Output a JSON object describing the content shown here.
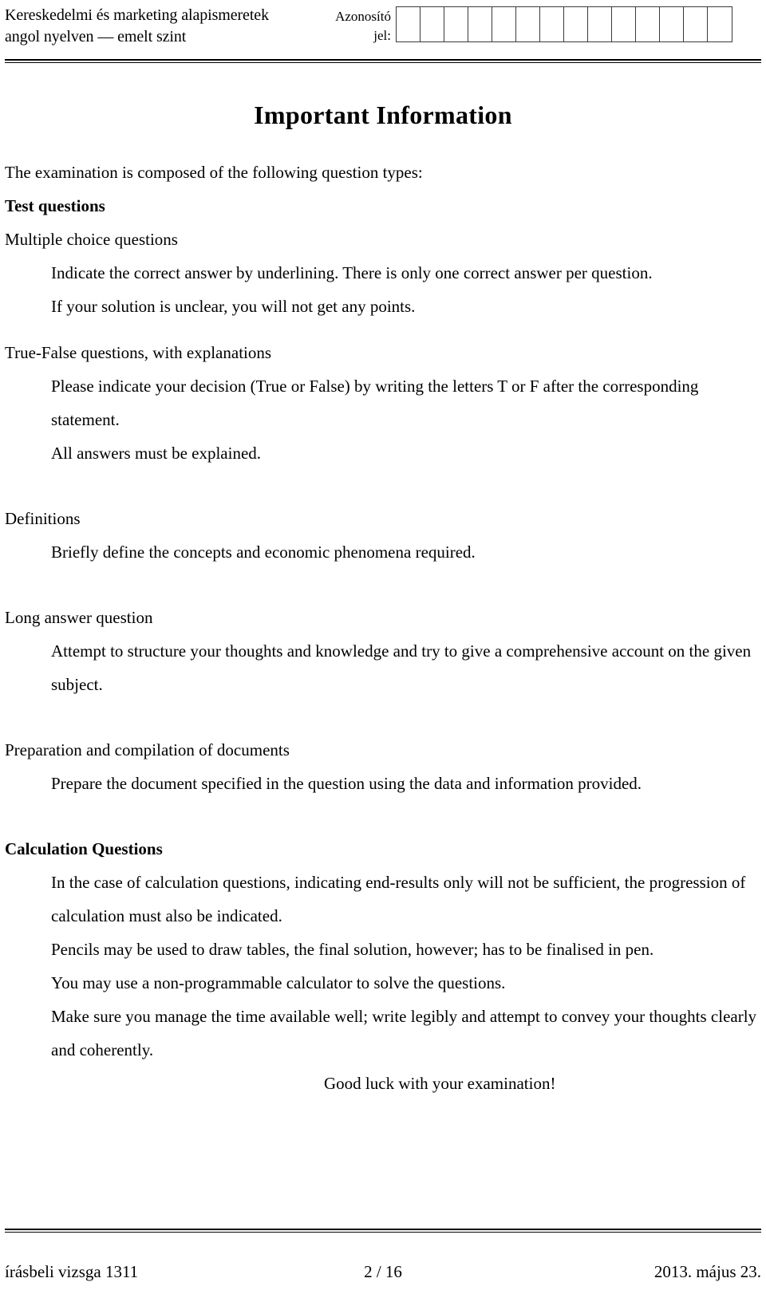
{
  "header": {
    "subject_line1": "Kereskedelmi és marketing alapismeretek",
    "subject_line2": "angol nyelven — emelt szint",
    "id_label_line1": "Azonosító",
    "id_label_line2": "jel:",
    "id_cell_count": 14
  },
  "document": {
    "title": "Important Information",
    "lead": "The examination is composed of the following question types:",
    "sections": [
      {
        "heading": "Test questions",
        "heading_bold": true,
        "subheading": "Multiple choice questions",
        "body": [
          "Indicate the correct answer by underlining. There is only one correct answer per question.",
          "If your solution is unclear, you will not get any points."
        ]
      },
      {
        "heading": "True-False questions, with explanations",
        "heading_bold": false,
        "body": [
          "Please indicate your decision (True or False) by writing the letters T or F after the corresponding statement.",
          "All answers must be explained."
        ]
      },
      {
        "heading": "Definitions",
        "heading_bold": false,
        "body": [
          "Briefly define the concepts and economic phenomena required."
        ]
      },
      {
        "heading": "Long answer question",
        "heading_bold": false,
        "body": [
          "Attempt to structure your thoughts and knowledge and try to give a comprehensive account on the given subject."
        ]
      },
      {
        "heading": "Preparation and compilation of documents",
        "heading_bold": false,
        "body": [
          "Prepare the document specified in the question using the data and information provided."
        ]
      },
      {
        "heading": "Calculation Questions",
        "heading_bold": true,
        "body": [
          "In the case of calculation questions, indicating end-results only will not be sufficient, the progression of calculation must also be indicated.",
          "Pencils may be used to draw tables, the final solution, however; has to be finalised in pen.",
          "You may use a non-programmable calculator to solve the questions.",
          "Make sure you manage the time available well; write legibly and attempt to convey your thoughts clearly and coherently."
        ]
      }
    ],
    "closing": "Good luck with your examination!"
  },
  "footer": {
    "left": "írásbeli vizsga 1311",
    "center": "2 / 16",
    "right": "2013. május 23."
  }
}
